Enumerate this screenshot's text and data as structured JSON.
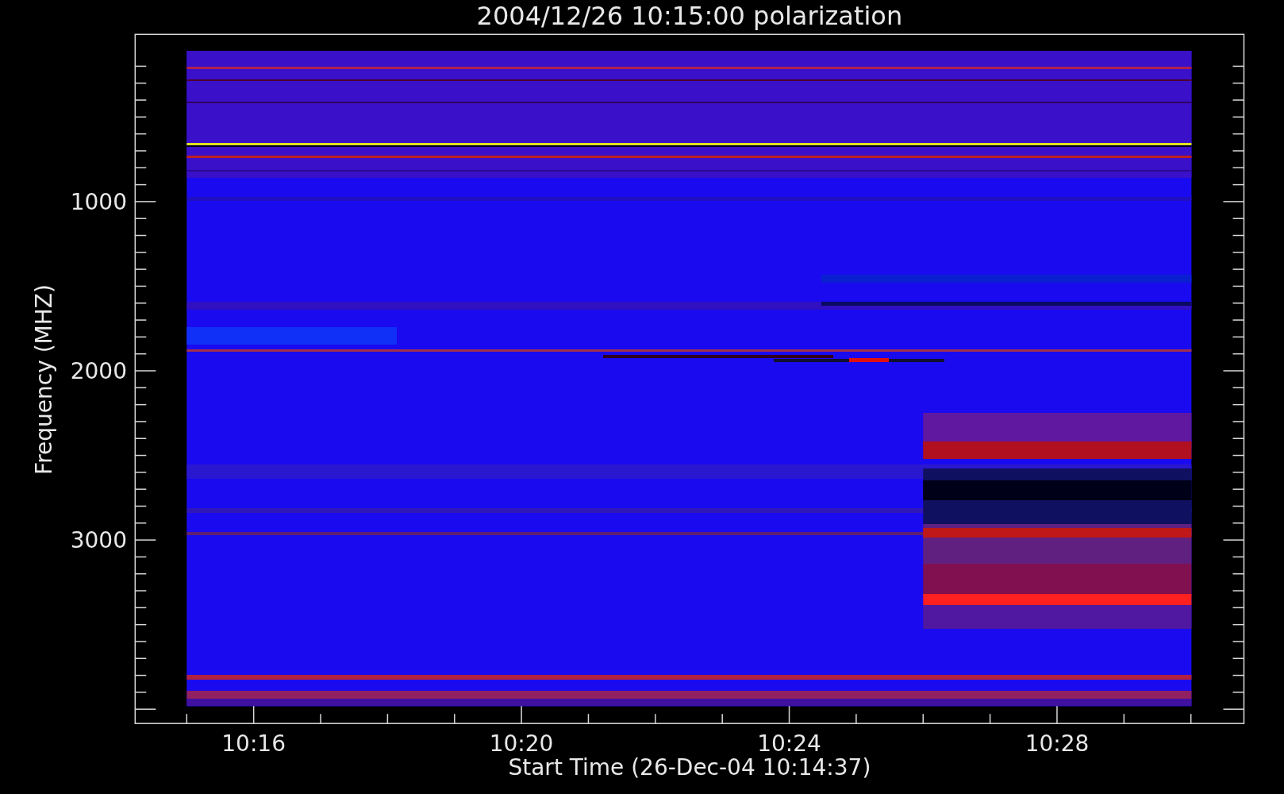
{
  "plot": {
    "title": "2004/12/26 10:15:00 polarization",
    "ylabel": "Frequency (MHZ)",
    "xlabel": "Start Time (26-Dec-04 10:14:37)",
    "xtick_labels": [
      "10:16",
      "10:20",
      "10:24",
      "10:28"
    ],
    "ytick_labels": [
      "1000",
      "2000",
      "3000"
    ]
  }
}
